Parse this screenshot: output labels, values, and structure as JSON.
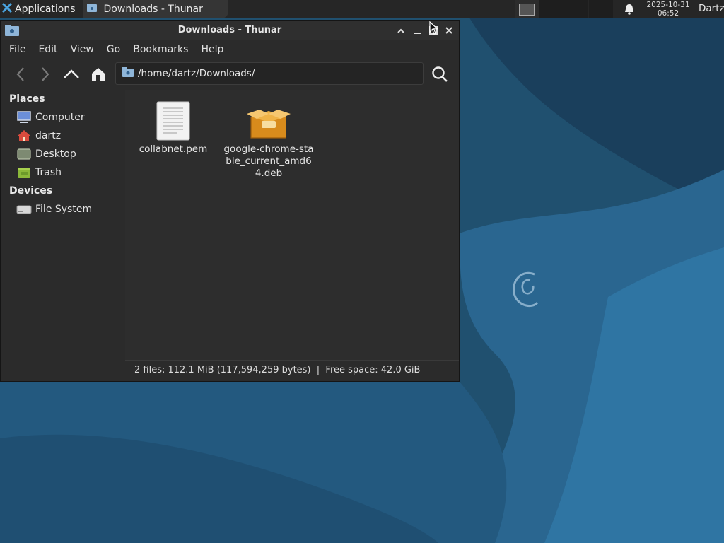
{
  "panel": {
    "apps_label": "Applications",
    "task_label": "Downloads - Thunar",
    "clock_date": "2025-10-31",
    "clock_time": "06:52",
    "user": "Dartz"
  },
  "window": {
    "title": "Downloads - Thunar",
    "menu": [
      "File",
      "Edit",
      "View",
      "Go",
      "Bookmarks",
      "Help"
    ],
    "location": "/home/dartz/Downloads/",
    "sidebar": {
      "places_header": "Places",
      "places": [
        "Computer",
        "dartz",
        "Desktop",
        "Trash"
      ],
      "devices_header": "Devices",
      "devices": [
        "File System"
      ]
    },
    "files": [
      {
        "name": "collabnet.pem",
        "icon": "text-file-icon"
      },
      {
        "name": "google-chrome-stable_current_amd64.deb",
        "icon": "package-icon"
      }
    ],
    "status": "2 files: 112.1 MiB (117,594,259 bytes)  |  Free space: 42.0 GiB"
  },
  "colors": {
    "desktop_bg": "#1f4e72",
    "panel_bg": "#262626",
    "window_bg": "#2b2b2b"
  }
}
